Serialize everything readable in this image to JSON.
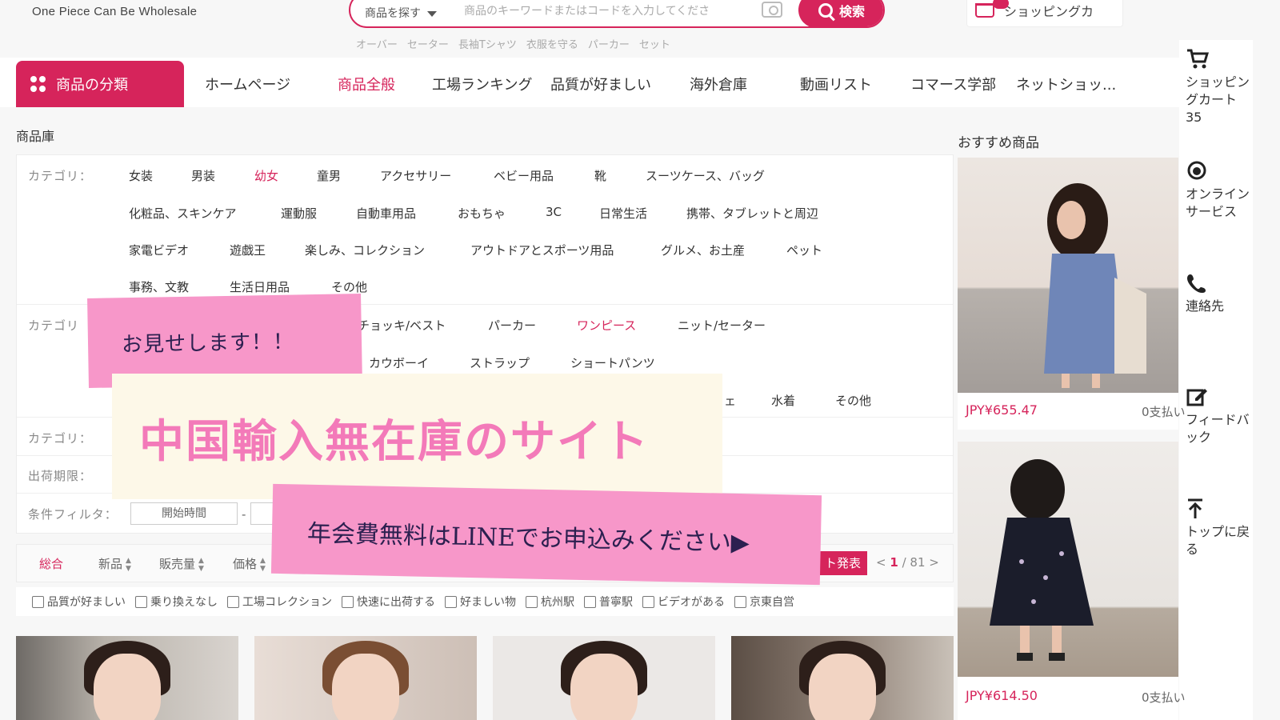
{
  "header": {
    "brand": "One Piece Can Be Wholesale",
    "search_category": "商品を探す",
    "search_placeholder": "商品のキーワードまたはコードを入力してくださ",
    "search_button": "検索",
    "hot_words": [
      "オーバー",
      "セーター",
      "長袖Tシャツ",
      "衣服を守る",
      "パーカー",
      "セット"
    ],
    "cart_label": "ショッピングカ"
  },
  "nav": {
    "category_button": "商品の分類",
    "items": [
      "ホームページ",
      "商品全般",
      "工場ランキング",
      "品質が好ましい",
      "海外倉庫",
      "動画リスト",
      "コマース学部",
      "ネットショッ..."
    ],
    "active": "商品全般"
  },
  "sidebar": {
    "cart": "ショッピングカート",
    "cart_count": "35",
    "service": "オンラインサービス",
    "contact": "連絡先",
    "feedback": "フィードバック",
    "top": "トップに戻る"
  },
  "library": {
    "title": "商品庫",
    "row1_label": "カテゴリ：",
    "row1": [
      "女装",
      "男装",
      "幼女",
      "童男",
      "アクセサリー",
      "ベビー用品",
      "靴",
      "スーツケース、バッグ",
      "化粧品、スキンケア",
      "運動服",
      "自動車用品",
      "おもちゃ",
      "3C",
      "日常生活",
      "携帯、タブレットと周辺",
      "家電ビデオ",
      "遊戯王",
      "楽しみ、コレクション",
      "アウトドアとスポーツ用品",
      "グルメ、お土産",
      "ペット",
      "事務、文教",
      "生活日用品",
      "その他"
    ],
    "row1_active": "幼女",
    "row2_label": "カテゴリ",
    "row2": [
      "チョッキ/ベスト",
      "パーカー",
      "ワンピース",
      "ニット/セーター",
      "カウボーイ",
      "ストラップ",
      "ショートパンツ",
      "ェ",
      "水着",
      "その他"
    ],
    "row2_active": "ワンピース",
    "row3_label": "カテゴリ：",
    "row4_label": "出荷期限：",
    "row5_label": "条件フィルタ：",
    "start_time": "開始時間",
    "dash": "-"
  },
  "sort": {
    "items": [
      "総合",
      "新品",
      "販売量",
      "価格"
    ],
    "active": "総合",
    "new_badge": "ト発表",
    "pager_prev": "<",
    "pager_current": "1",
    "pager_total": "/ 81",
    "pager_next": ">"
  },
  "checks": [
    "品質が好ましい",
    "乗り換えなし",
    "工場コレクション",
    "快速に出荷する",
    "好ましい物",
    "杭州駅",
    "普寧駅",
    "ビデオがある",
    "京東自営"
  ],
  "recommend": {
    "title": "おすすめ商品",
    "items": [
      {
        "price": "JPY¥655.47",
        "sold": "0支払い"
      },
      {
        "price": "JPY¥614.50",
        "sold": "0支払い"
      }
    ]
  },
  "overlay": {
    "show": "お見せします！！",
    "main": "中国輸入無在庫のサイト",
    "line": "年会費無料はLINEでお申込みください▶"
  },
  "colors": {
    "accent": "#d6245b",
    "banner_pink": "#f797c9",
    "banner_cream": "#fdf8e8",
    "title_pink": "#f37ab9"
  }
}
